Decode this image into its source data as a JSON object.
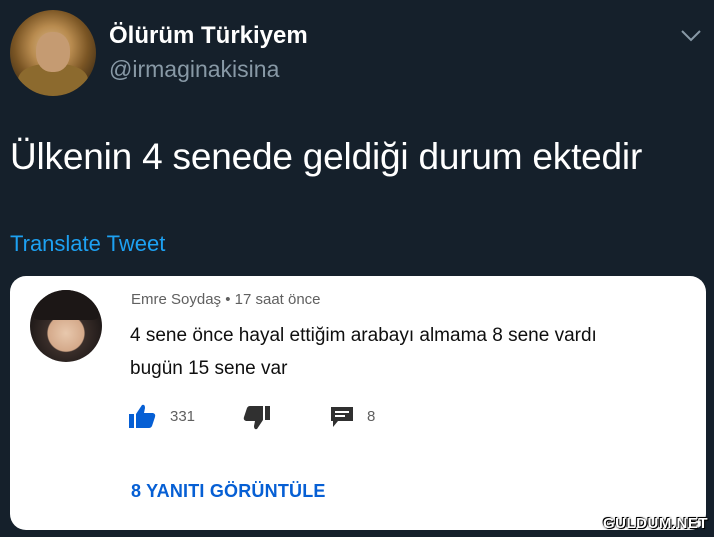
{
  "tweet": {
    "display_name": "Ölürüm Türkiyem",
    "handle": "@irmaginakisina",
    "text": "Ülkenin 4 senede geldiği durum ektedir",
    "translate_label": "Translate Tweet",
    "menu_icon": "chevron-down-icon",
    "avatar_icon": "avatar"
  },
  "embedded_comment": {
    "author": "Emre Soydaş",
    "separator": "•",
    "time": "17 saat önce",
    "meta_line": "Emre Soydaş • 17 saat önce",
    "line1": "4 sene önce hayal ettiğim arabayı almama 8 sene vardı",
    "line2": "bugün 15 sene var",
    "likes": "331",
    "replies_count": "8",
    "view_replies_label": "8 YANITI GÖRÜNTÜLE",
    "icons": [
      "thumbs-up-icon",
      "thumbs-down-icon",
      "reply-icon",
      "more-vertical-icon"
    ]
  },
  "colors": {
    "background": "#15202b",
    "secondary_text": "#8899a6",
    "link": "#1da1f2",
    "youtube_blue": "#065fd4"
  },
  "watermark": "GULDUM.NET"
}
